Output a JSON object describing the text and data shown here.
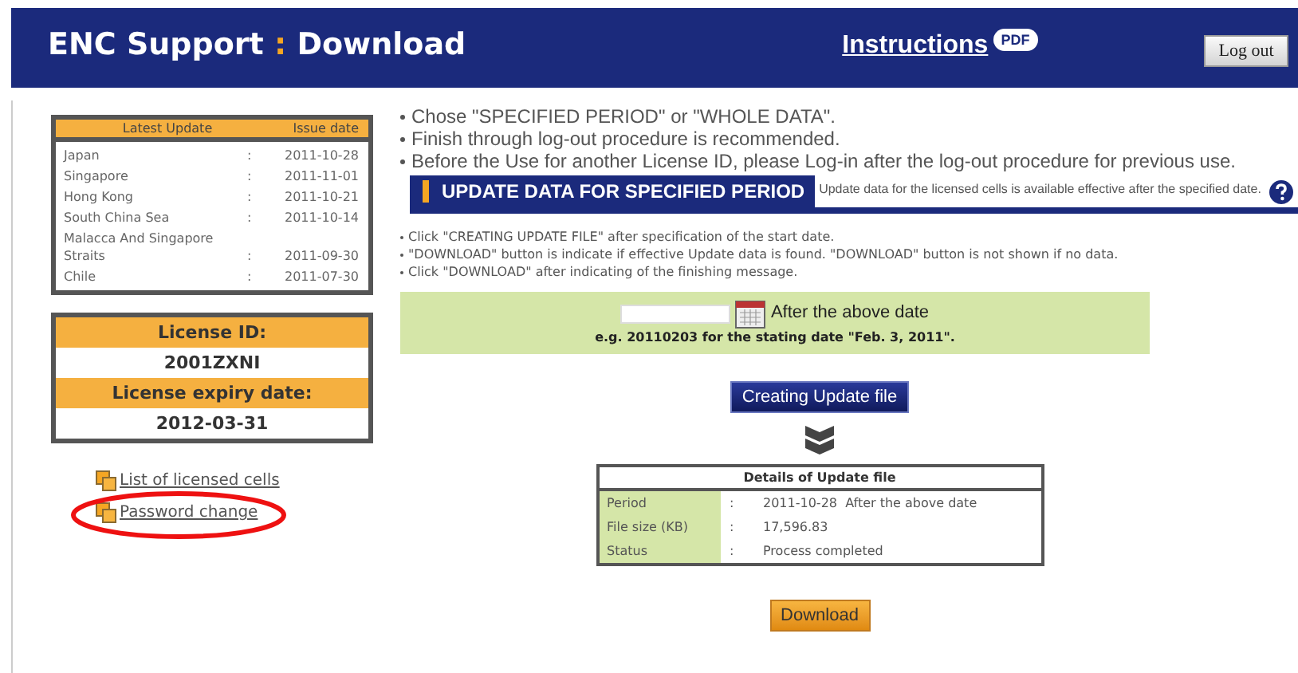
{
  "header": {
    "title_part1": "ENC Support",
    "separator": ":",
    "title_part2": "Download",
    "instructions_link": "Instructions",
    "pdf_badge": "PDF",
    "logout_button": "Log out"
  },
  "latest_update": {
    "columns": [
      "Latest Update",
      "Issue date"
    ],
    "rows": [
      {
        "area": "Japan",
        "sep": ":",
        "date": "2011-10-28"
      },
      {
        "area": "Singapore",
        "sep": ":",
        "date": "2011-11-01"
      },
      {
        "area": "Hong Kong",
        "sep": ":",
        "date": "2011-10-21"
      },
      {
        "area": "South China Sea",
        "sep": ":",
        "date": "2011-10-14"
      },
      {
        "area": "Malacca And Singapore Straits",
        "sep": ":",
        "date": "2011-09-30"
      },
      {
        "area": "Chile",
        "sep": ":",
        "date": "2011-07-30"
      }
    ]
  },
  "license": {
    "id_label": "License ID:",
    "id_value": "2001ZXNI",
    "expiry_label": "License expiry date:",
    "expiry_value": "2012-03-31"
  },
  "links": [
    {
      "label": "List of licensed cells",
      "circled": false
    },
    {
      "label": "Password change",
      "circled": true
    }
  ],
  "notes": [
    "Chose \"SPECIFIED PERIOD\" or \"WHOLE DATA\".",
    "Finish through log-out procedure is recommended.",
    "Before the Use for another License ID, please Log-in after the log-out procedure for previous use."
  ],
  "section": {
    "title": "UPDATE DATA FOR SPECIFIED PERIOD",
    "description": "Update data for the licensed cells is available effective after the specified date."
  },
  "steps": [
    "Click \"CREATING UPDATE FILE\" after specification of the start date.",
    "\"DOWNLOAD\" button is indicate if effective Update data is found. \"DOWNLOAD\" button is not shown if no data.",
    "Click \"DOWNLOAD\" after indicating of the finishing message."
  ],
  "date_box": {
    "suffix": "After the above date",
    "example": "e.g. 20110203 for the stating date \"Feb. 3, 2011\"."
  },
  "create_button": "Creating Update file",
  "details": {
    "title": "Details of Update file",
    "rows": [
      {
        "label": "Period",
        "sep": ":",
        "value": "2011-10-28  After the above date"
      },
      {
        "label": "File size (KB)",
        "sep": ":",
        "value": "17,596.83"
      },
      {
        "label": "Status",
        "sep": ":",
        "value": "Process completed"
      }
    ]
  },
  "download_button": "Download"
}
